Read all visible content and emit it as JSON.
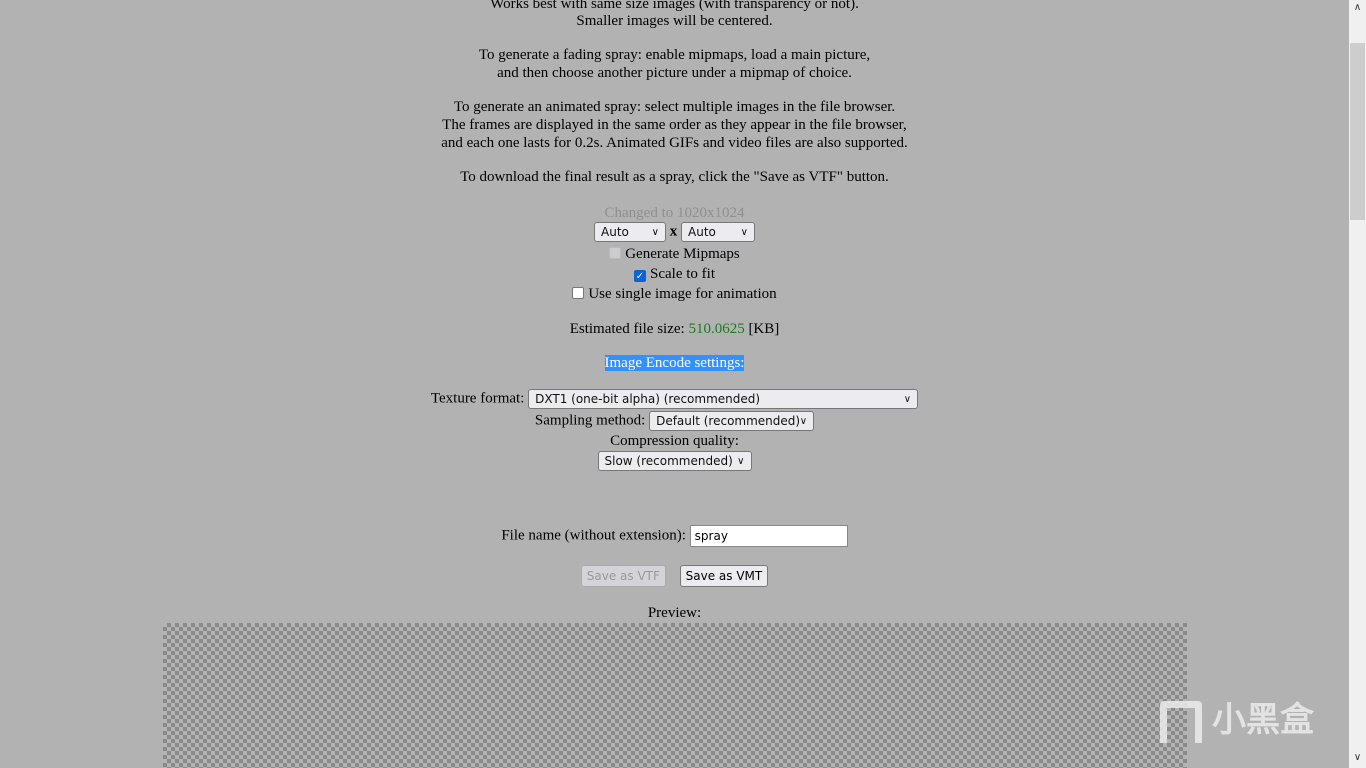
{
  "instructions": {
    "line1": "Works best with same size images (with transparency or not).",
    "line2": "Smaller images will be centered.",
    "fading1": "To generate a fading spray: enable mipmaps, load a main picture,",
    "fading2": "and then choose another picture under a mipmap of choice.",
    "anim1": "To generate an animated spray: select multiple images in the file browser.",
    "anim2": "The frames are displayed in the same order as they appear in the file browser,",
    "anim3": "and each one lasts for 0.2s. Animated GIFs and video files are also supported.",
    "download": "To download the final result as a spray, click the \"Save as VTF\" button."
  },
  "size": {
    "status": "Changed to 1020x1024",
    "width_value": "Auto",
    "separator": "x",
    "height_value": "Auto"
  },
  "options": {
    "generate_mipmaps": {
      "label": "Generate Mipmaps",
      "checked": false,
      "disabled": true
    },
    "scale_to_fit": {
      "label": "Scale to fit",
      "checked": true
    },
    "single_image": {
      "label": "Use single image for animation",
      "checked": false
    }
  },
  "filesize": {
    "label": "Estimated file size:",
    "value": "510.0625",
    "unit": "[KB]",
    "value_color": "#1f7a1f"
  },
  "encode": {
    "heading": "Image Encode settings:",
    "texture_label": "Texture format:",
    "texture_value": "DXT1 (one-bit alpha) (recommended)",
    "sampling_label": "Sampling method:",
    "sampling_value": "Default (recommended)",
    "quality_label": "Compression quality:",
    "quality_value": "Slow (recommended)"
  },
  "file": {
    "label": "File name (without extension):",
    "value": "spray"
  },
  "buttons": {
    "save_vtf": "Save as VTF",
    "save_vmt": "Save as VMT"
  },
  "preview": {
    "label": "Preview:"
  },
  "watermark": {
    "text": "小黑盒"
  },
  "icons": {
    "chevron": "chevron-down-icon",
    "check": "checkmark-icon"
  }
}
